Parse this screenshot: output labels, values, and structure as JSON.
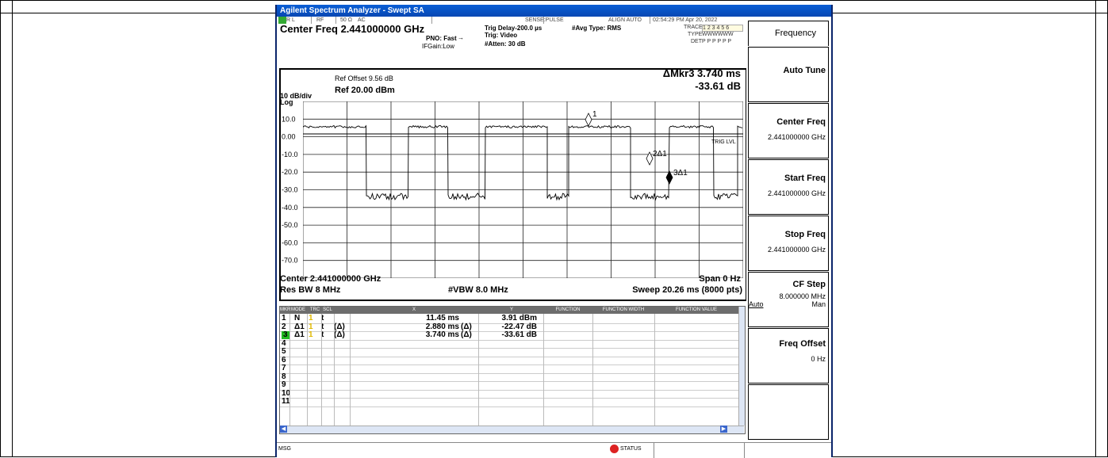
{
  "window_title": "Agilent Spectrum Analyzer - Swept SA",
  "status_bar": {
    "rl": "R L",
    "rf": "RF",
    "impedance": "50 Ω",
    "coupling": "AC",
    "sense": "SENSE:PULSE",
    "align": "ALIGN AUTO",
    "datetime": "02:54:29 PM Apr 20, 2022"
  },
  "header": {
    "center_freq": "Center Freq 2.441000000 GHz",
    "pno": "PNO: Fast",
    "ifgain": "IFGain:Low",
    "trig_delay": "Trig Delay-200.0 µs",
    "trig": "Trig: Video",
    "atten": "#Atten: 30 dB",
    "avg_type": "#Avg Type: RMS",
    "trace_label": "TRACE",
    "trace_vals": "1 2 3 4 5 6",
    "type_label": "TYPE",
    "type_vals": "WWWWWW",
    "det_label": "DET",
    "det_vals": "P P P P P P"
  },
  "graph": {
    "ref_offset": "Ref Offset 9.56 dB",
    "scale": "10 dB/div",
    "ref": "Ref 20.00 dBm",
    "log": "Log",
    "marker_readout_1": "ΔMkr3 3.740 ms",
    "marker_readout_2": "-33.61 dB",
    "y_ticks": [
      "10.0",
      "0.00",
      "-10.0",
      "-20.0",
      "-30.0",
      "-40.0",
      "-50.0",
      "-60.0",
      "-70.0"
    ],
    "trig_lvl": "TRIG LVL",
    "marker_labels": [
      "1",
      "2Δ1",
      "3Δ1"
    ],
    "center": "Center 2.441000000 GHz",
    "span": "Span 0 Hz",
    "res_bw": "Res BW 8 MHz",
    "vbw": "#VBW 8.0 MHz",
    "sweep": "Sweep  20.26 ms (8000 pts)"
  },
  "table": {
    "headers": [
      "MKR",
      "MODE",
      "TRC",
      "SCL",
      "X",
      "Y",
      "FUNCTION",
      "FUNCTION WIDTH",
      "FUNCTION VALUE"
    ],
    "rows": [
      {
        "n": "1",
        "mode": "N",
        "trc": "1",
        "scl": "t",
        "xd": "",
        "x": "11.45 ms",
        "yd": "",
        "y": "3.91 dBm"
      },
      {
        "n": "2",
        "mode": "Δ1",
        "trc": "1",
        "scl": "t",
        "xd": "(Δ)",
        "x": "2.880 ms",
        "yd": "(Δ)",
        "y": "-22.47 dB"
      },
      {
        "n": "3",
        "mode": "Δ1",
        "trc": "1",
        "scl": "t",
        "xd": "(Δ)",
        "x": "3.740 ms",
        "yd": "(Δ)",
        "y": "-33.61 dB"
      },
      {
        "n": "4",
        "mode": "",
        "trc": "",
        "scl": "",
        "xd": "",
        "x": "",
        "yd": "",
        "y": ""
      },
      {
        "n": "5",
        "mode": "",
        "trc": "",
        "scl": "",
        "xd": "",
        "x": "",
        "yd": "",
        "y": ""
      },
      {
        "n": "6",
        "mode": "",
        "trc": "",
        "scl": "",
        "xd": "",
        "x": "",
        "yd": "",
        "y": ""
      },
      {
        "n": "7",
        "mode": "",
        "trc": "",
        "scl": "",
        "xd": "",
        "x": "",
        "yd": "",
        "y": ""
      },
      {
        "n": "8",
        "mode": "",
        "trc": "",
        "scl": "",
        "xd": "",
        "x": "",
        "yd": "",
        "y": ""
      },
      {
        "n": "9",
        "mode": "",
        "trc": "",
        "scl": "",
        "xd": "",
        "x": "",
        "yd": "",
        "y": ""
      },
      {
        "n": "10",
        "mode": "",
        "trc": "",
        "scl": "",
        "xd": "",
        "x": "",
        "yd": "",
        "y": ""
      },
      {
        "n": "11",
        "mode": "",
        "trc": "",
        "scl": "",
        "xd": "",
        "x": "",
        "yd": "",
        "y": ""
      }
    ]
  },
  "softkeys": {
    "menu_title": "Frequency",
    "auto_tune": "Auto Tune",
    "center_freq": "Center Freq",
    "center_freq_val": "2.441000000 GHz",
    "start_freq": "Start Freq",
    "start_freq_val": "2.441000000 GHz",
    "stop_freq": "Stop Freq",
    "stop_freq_val": "2.441000000 GHz",
    "cf_step": "CF Step",
    "cf_step_val": "8.000000 MHz",
    "cf_auto": "Auto",
    "cf_man": "Man",
    "freq_offset": "Freq Offset",
    "freq_offset_val": "0 Hz"
  },
  "msg_bar": {
    "msg": "MSG",
    "status": "STATUS"
  },
  "colors": {
    "title_bar": "#0747b3",
    "marker_active": "#22bb22",
    "trace_color": "#ffcc00"
  }
}
